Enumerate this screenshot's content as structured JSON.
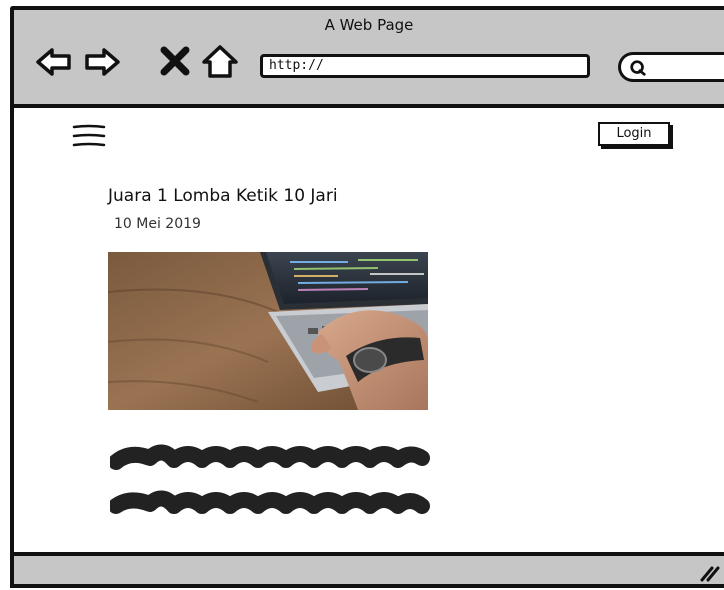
{
  "window": {
    "title": "A Web Page"
  },
  "toolbar": {
    "back_icon": "arrow-left-icon",
    "forward_icon": "arrow-right-icon",
    "stop_icon": "close-icon",
    "home_icon": "home-icon",
    "url_value": "http://",
    "search_icon": "search-icon"
  },
  "header": {
    "menu_icon": "hamburger-menu-icon",
    "login_label": "Login"
  },
  "post": {
    "title": "Juara 1 Lomba Ketik 10 Jari",
    "date": "10 Mei 2019",
    "image_subject": "hands typing on laptop keyboard"
  },
  "colors": {
    "chrome_gray": "#c6c6c6",
    "outline": "#111111",
    "background": "#ffffff"
  }
}
